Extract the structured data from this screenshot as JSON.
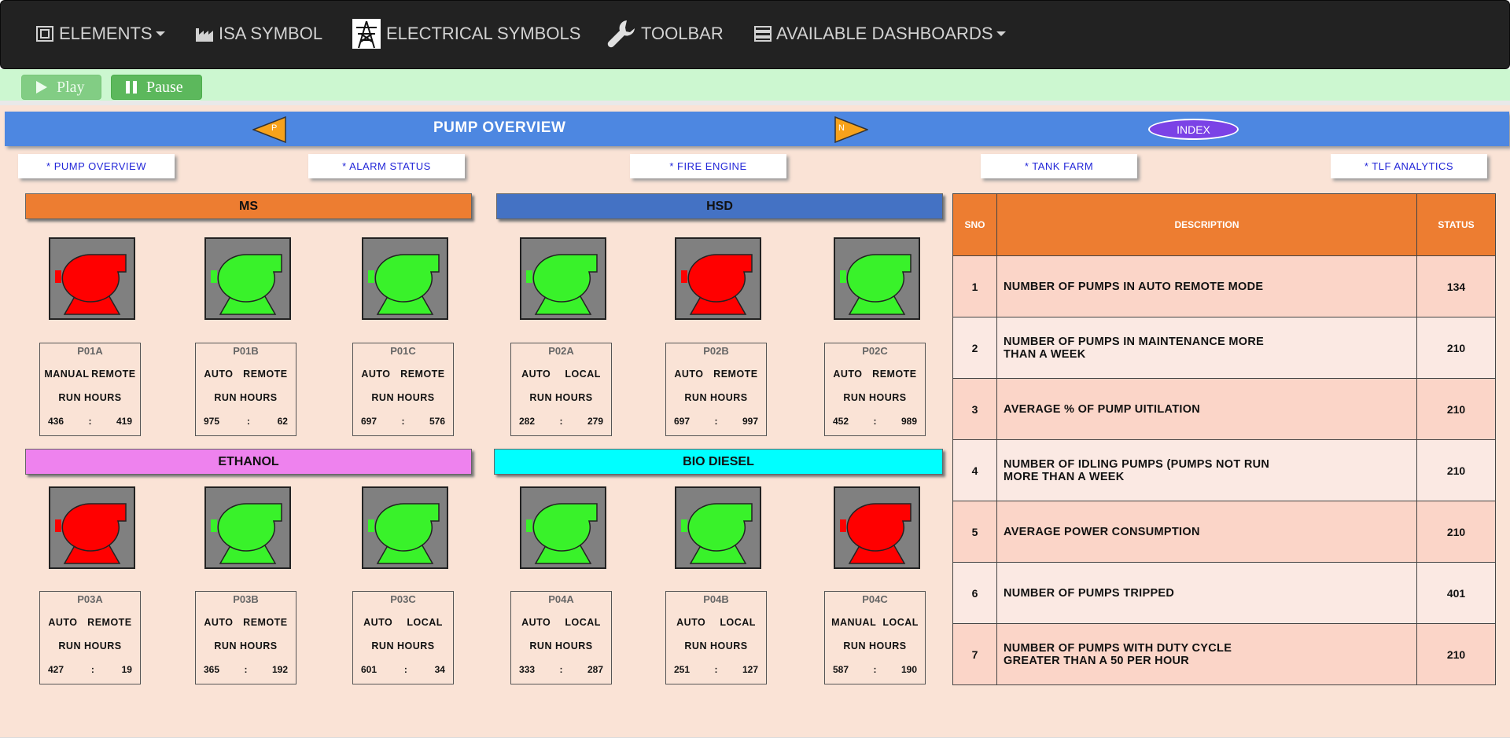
{
  "nav": {
    "elements": "ELEMENTS",
    "isa_symbol": "ISA SYMBOL",
    "electrical_symbols": "ELECTRICAL SYMBOLS",
    "toolbar": "TOOLBAR",
    "available_dashboards": "AVAILABLE DASHBOARDS"
  },
  "controls": {
    "play": "Play",
    "pause": "Pause"
  },
  "banner": {
    "title": "PUMP OVERVIEW",
    "prev": "P",
    "next": "N",
    "index": "INDEX"
  },
  "links": [
    "* PUMP OVERVIEW",
    "* ALARM STATUS",
    "* FIRE ENGINE",
    "* TANK FARM",
    "* TLF ANALYTICS"
  ],
  "groups": [
    {
      "name": "MS",
      "color": "#ed7d31"
    },
    {
      "name": "HSD",
      "color": "#4472c4"
    },
    {
      "name": "ETHANOL",
      "color": "#ee82ee"
    },
    {
      "name": "BIO DIESEL",
      "color": "#00ffff"
    }
  ],
  "pumps": [
    {
      "id": "P01A",
      "mode1": "MANUAL",
      "mode2": "REMOTE",
      "run_label": "RUN HOURS",
      "h1": "436",
      "sep": ":",
      "h2": "419",
      "status_color": "#ff0000"
    },
    {
      "id": "P01B",
      "mode1": "AUTO",
      "mode2": "REMOTE",
      "run_label": "RUN HOURS",
      "h1": "975",
      "sep": ":",
      "h2": "62",
      "status_color": "#39f22a"
    },
    {
      "id": "P01C",
      "mode1": "AUTO",
      "mode2": "REMOTE",
      "run_label": "RUN HOURS",
      "h1": "697",
      "sep": ":",
      "h2": "576",
      "status_color": "#39f22a"
    },
    {
      "id": "P02A",
      "mode1": "AUTO",
      "mode2": "LOCAL",
      "run_label": "RUN HOURS",
      "h1": "282",
      "sep": ":",
      "h2": "279",
      "status_color": "#39f22a"
    },
    {
      "id": "P02B",
      "mode1": "AUTO",
      "mode2": "REMOTE",
      "run_label": "RUN HOURS",
      "h1": "697",
      "sep": ":",
      "h2": "997",
      "status_color": "#ff0000"
    },
    {
      "id": "P02C",
      "mode1": "AUTO",
      "mode2": "REMOTE",
      "run_label": "RUN HOURS",
      "h1": "452",
      "sep": ":",
      "h2": "989",
      "status_color": "#39f22a"
    },
    {
      "id": "P03A",
      "mode1": "AUTO",
      "mode2": "REMOTE",
      "run_label": "RUN HOURS",
      "h1": "427",
      "sep": ":",
      "h2": "19",
      "status_color": "#ff0000"
    },
    {
      "id": "P03B",
      "mode1": "AUTO",
      "mode2": "REMOTE",
      "run_label": "RUN HOURS",
      "h1": "365",
      "sep": ":",
      "h2": "192",
      "status_color": "#39f22a"
    },
    {
      "id": "P03C",
      "mode1": "AUTO",
      "mode2": "LOCAL",
      "run_label": "RUN HOURS",
      "h1": "601",
      "sep": ":",
      "h2": "34",
      "status_color": "#39f22a"
    },
    {
      "id": "P04A",
      "mode1": "AUTO",
      "mode2": "LOCAL",
      "run_label": "RUN HOURS",
      "h1": "333",
      "sep": ":",
      "h2": "287",
      "status_color": "#39f22a"
    },
    {
      "id": "P04B",
      "mode1": "AUTO",
      "mode2": "LOCAL",
      "run_label": "RUN HOURS",
      "h1": "251",
      "sep": ":",
      "h2": "127",
      "status_color": "#39f22a"
    },
    {
      "id": "P04C",
      "mode1": "MANUAL",
      "mode2": "LOCAL",
      "run_label": "RUN HOURS",
      "h1": "587",
      "sep": ":",
      "h2": "190",
      "status_color": "#ff0000"
    }
  ],
  "table": {
    "headers": {
      "sno": "SNO",
      "description": "DESCRIPTION",
      "status": "STATUS"
    },
    "rows": [
      {
        "sno": "1",
        "desc": "NUMBER OF PUMPS IN AUTO REMOTE MODE",
        "status": "134"
      },
      {
        "sno": "2",
        "desc": "NUMBER OF PUMPS IN MAINTENANCE MORE THAN A WEEK",
        "status": "210"
      },
      {
        "sno": "3",
        "desc": "AVERAGE % OF PUMP UITILATION",
        "status": "210"
      },
      {
        "sno": "4",
        "desc": "NUMBER OF IDLING PUMPS (PUMPS NOT RUN MORE THAN A WEEK",
        "status": "210"
      },
      {
        "sno": "5",
        "desc": "AVERAGE POWER CONSUMPTION",
        "status": "210"
      },
      {
        "sno": "6",
        "desc": "NUMBER OF PUMPS TRIPPED",
        "status": "401"
      },
      {
        "sno": "7",
        "desc": "NUMBER OF PUMPS WITH DUTY CYCLE GREATER THAN A 50 PER HOUR",
        "status": "210"
      }
    ]
  }
}
